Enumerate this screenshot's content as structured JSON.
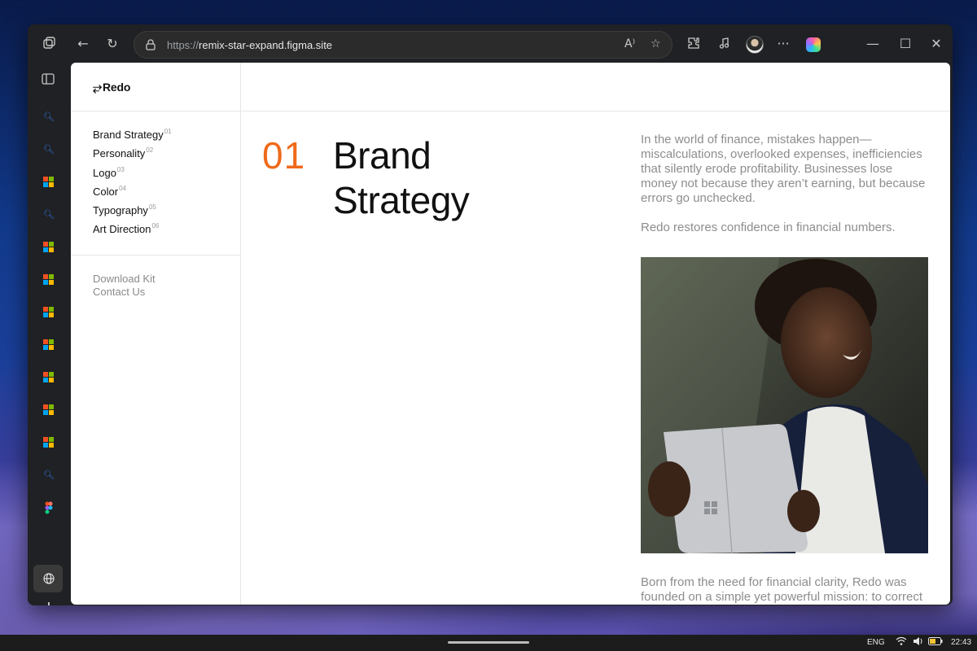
{
  "browser": {
    "url_scheme": "https://",
    "url_host": "remix-star-expand.figma.site",
    "icons": {
      "workspaces": "workspaces-icon",
      "back": "←",
      "refresh": "↻",
      "read_aloud": "A⁾",
      "favorite": "☆",
      "extensions": "puzzle-icon",
      "more": "···",
      "minimize": "—",
      "maximize": "☐",
      "close": "✕",
      "new_tab": "+"
    }
  },
  "site": {
    "logo_text": "Redo",
    "nav": [
      {
        "label": "Brand Strategy",
        "num": "01"
      },
      {
        "label": "Personality",
        "num": "02"
      },
      {
        "label": "Logo",
        "num": "03"
      },
      {
        "label": "Color",
        "num": "04"
      },
      {
        "label": "Typography",
        "num": "05"
      },
      {
        "label": "Art Direction",
        "num": "06"
      }
    ],
    "secondary_nav": [
      "Download Kit",
      "Contact Us"
    ],
    "section": {
      "number": "01",
      "title_line1": "Brand",
      "title_line2": "Strategy",
      "paragraph1": "In the world of finance, mistakes happen—miscalculations, overlooked expenses, inefficiencies that silently erode profitability. Businesses lose money not because they aren’t earning, but because errors go unchecked.",
      "paragraph2": "Redo restores confidence in financial numbers.",
      "paragraph3": "Born from the need for financial clarity, Redo was founded on a simple yet powerful mission: to correct"
    },
    "accent_color": "#ef6a1a"
  },
  "taskbar": {
    "language": "ENG",
    "time": "22:43"
  }
}
